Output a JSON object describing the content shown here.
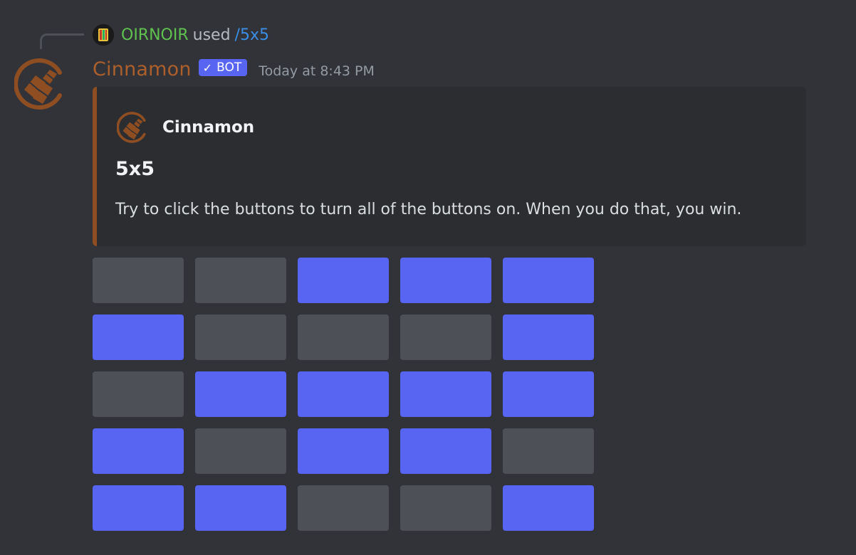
{
  "reply": {
    "user": "OIRNOIR",
    "used": "used",
    "command": "/5x5"
  },
  "message": {
    "author": "Cinnamon",
    "bot_tag": "BOT",
    "bot_check": "✓",
    "timestamp": "Today at 8:43 PM"
  },
  "embed": {
    "author_name": "Cinnamon",
    "title": "5x5",
    "description": "Try to click the buttons to turn all of the buttons on. When you do that, you win.",
    "color": "#8f4e22"
  },
  "colors": {
    "on": "#5865f2",
    "off": "#4e5058",
    "author": "#ad5f2b",
    "reply_user": "#5fc24f"
  },
  "grid": [
    [
      "off",
      "off",
      "on",
      "on",
      "on"
    ],
    [
      "on",
      "off",
      "off",
      "off",
      "on"
    ],
    [
      "off",
      "on",
      "on",
      "on",
      "on"
    ],
    [
      "on",
      "off",
      "on",
      "on",
      "off"
    ],
    [
      "on",
      "on",
      "off",
      "off",
      "on"
    ]
  ]
}
